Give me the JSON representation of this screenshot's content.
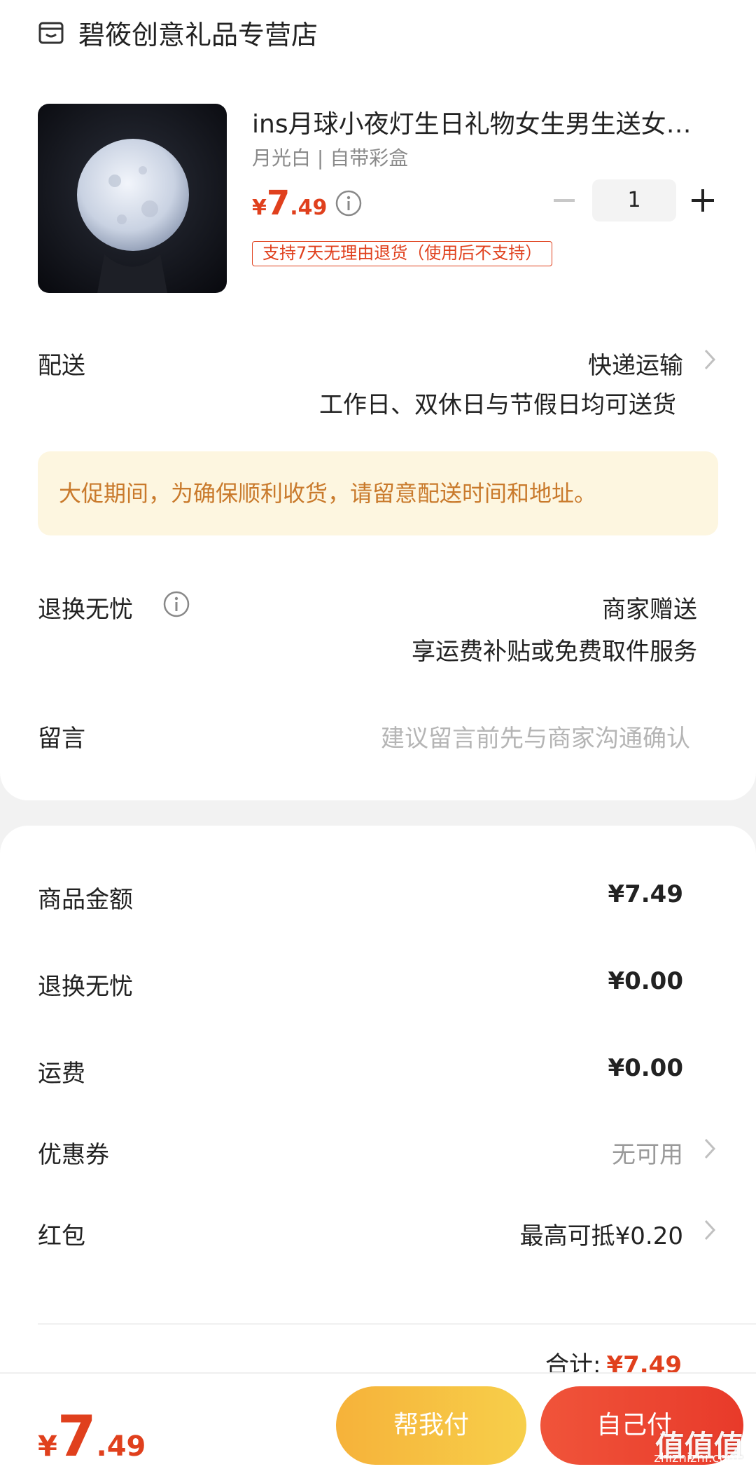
{
  "shop": {
    "name": "碧筱创意礼品专营店",
    "icon": "store-icon"
  },
  "product": {
    "title": "ins月球小夜灯生日礼物女生男生送女友闺蜜",
    "spec": "月光白 | 自带彩盒",
    "price": {
      "currency": "¥",
      "integer": "7",
      "decimal": ".49"
    },
    "quantity": "1",
    "return_tag": "支持7天无理由退货（使用后不支持）"
  },
  "delivery": {
    "label": "配送",
    "method": "快递运输",
    "note": "工作日、双休日与节假日均可送货"
  },
  "notice": "大促期间，为确保顺利收货，请留意配送时间和地址。",
  "worry_free": {
    "label": "退换无忧",
    "value": "商家赠送",
    "note": "享运费补贴或免费取件服务"
  },
  "message": {
    "label": "留言",
    "placeholder": "建议留言前先与商家沟通确认"
  },
  "summary": {
    "goods_amount": {
      "label": "商品金额",
      "value": "¥7.49"
    },
    "worry_free": {
      "label": "退换无忧",
      "value": "¥0.00"
    },
    "shipping": {
      "label": "运费",
      "value": "¥0.00"
    },
    "coupon": {
      "label": "优惠券",
      "value": "无可用"
    },
    "red_packet": {
      "label": "红包",
      "value": "最高可抵¥0.20"
    },
    "total_label": "合计:",
    "total_value": "¥7.49"
  },
  "bottom": {
    "price": {
      "currency": "¥",
      "integer": "7",
      "decimal": ".49"
    },
    "help_pay": "帮我付",
    "self_pay": "自己付",
    "watermark": "值值值",
    "watermark_url": "zhizhizhi.com"
  },
  "colors": {
    "accent": "#e0401d",
    "notice_bg": "#fdf6e0",
    "notice_text": "#c97a2c"
  }
}
